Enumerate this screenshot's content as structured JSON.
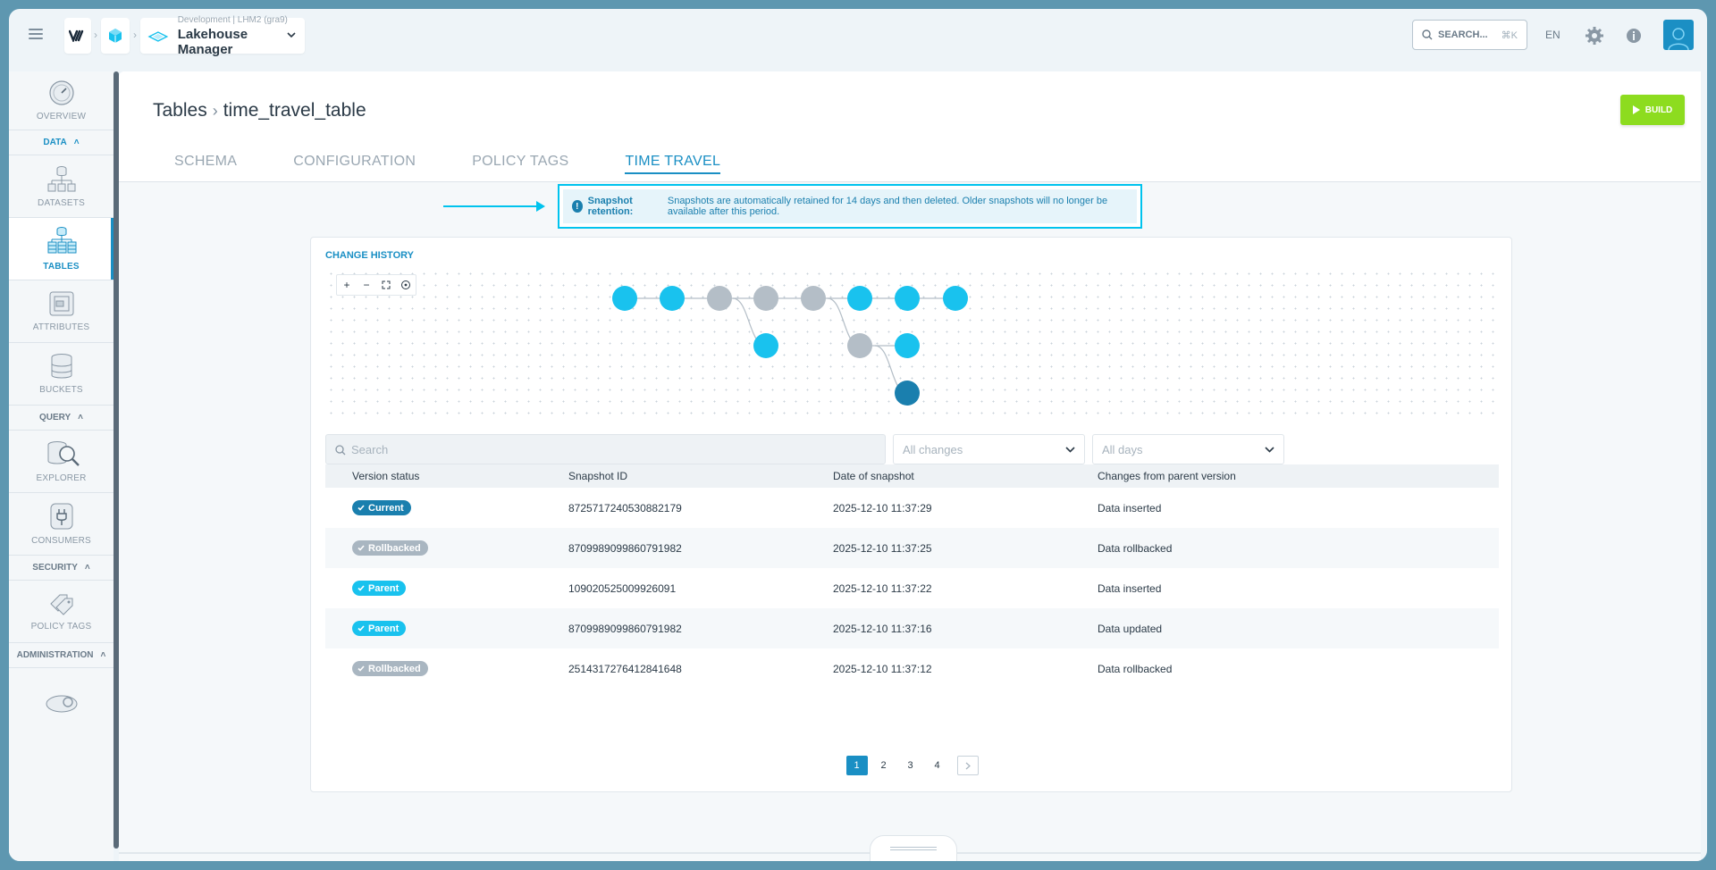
{
  "app": {
    "env_line": "Development | LHM2 (gra9)",
    "name": "Lakehouse Manager"
  },
  "topbar": {
    "search_label": "SEARCH...",
    "search_shortcut": "⌘K",
    "language": "EN"
  },
  "sidebar": {
    "overview": "OVERVIEW",
    "section_data": "DATA",
    "datasets": "DATASETS",
    "tables": "TABLES",
    "attributes": "ATTRIBUTES",
    "buckets": "BUCKETS",
    "section_query": "QUERY",
    "explorer": "EXPLORER",
    "consumers": "CONSUMERS",
    "section_security": "SECURITY",
    "policy_tags": "POLICY TAGS",
    "section_administration": "ADMINISTRATION"
  },
  "page": {
    "breadcrumb_root": "Tables",
    "breadcrumb_current": "time_travel_table",
    "build_label": "BUILD"
  },
  "tabs": [
    "SCHEMA",
    "CONFIGURATION",
    "POLICY TAGS",
    "TIME TRAVEL"
  ],
  "notice": {
    "title": "Snapshot retention:",
    "text": "Snapshots are automatically retained for 14 days and then deleted. Older snapshots will no longer be available after this period."
  },
  "history": {
    "title": "CHANGE HISTORY",
    "search_placeholder": "Search",
    "filter_changes": "All changes",
    "filter_days": "All days",
    "columns": [
      "Version status",
      "Snapshot ID",
      "Date of snapshot",
      "Changes from parent version"
    ],
    "rows": [
      {
        "status": "Current",
        "status_color": "#1a7fae",
        "id": "8725717240530882179",
        "date": "2025-12-10 11:37:29",
        "change": "Data inserted"
      },
      {
        "status": "Rollbacked",
        "status_color": "#a9b6c1",
        "id": "8709989099860791982",
        "date": "2025-12-10 11:37:25",
        "change": "Data rollbacked"
      },
      {
        "status": "Parent",
        "status_color": "#19c2ee",
        "id": "109020525009926091",
        "date": "2025-12-10 11:37:22",
        "change": "Data inserted"
      },
      {
        "status": "Parent",
        "status_color": "#19c2ee",
        "id": "8709989099860791982",
        "date": "2025-12-10 11:37:16",
        "change": "Data updated"
      },
      {
        "status": "Rollbacked",
        "status_color": "#a9b6c1",
        "id": "2514317276412841648",
        "date": "2025-12-10 11:37:12",
        "change": "Data rollbacked"
      }
    ],
    "pages": [
      "1",
      "2",
      "3",
      "4"
    ],
    "current_page": "1"
  },
  "colors": {
    "accent": "#1a8fc4",
    "cyan": "#19c2ee",
    "grey_node": "#b4bec7",
    "current_node": "#1a7fae",
    "build": "#8ddc1f"
  }
}
